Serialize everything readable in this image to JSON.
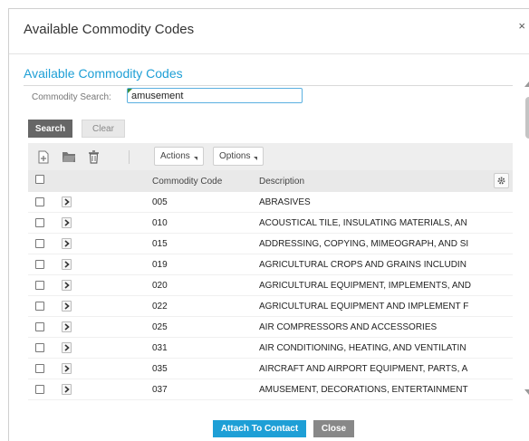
{
  "dialog": {
    "title": "Available Commodity Codes",
    "close_glyph": "×"
  },
  "section": {
    "title": "Available Commodity Codes"
  },
  "search": {
    "label": "Commodity Search:",
    "value": "amusement",
    "search_button": "Search",
    "clear_button": "Clear"
  },
  "toolbar": {
    "icons": [
      "add-icon",
      "folder-icon",
      "trash-icon"
    ],
    "actions_label": "Actions",
    "options_label": "Options"
  },
  "grid": {
    "columns": [
      "Commodity Code",
      "Description"
    ],
    "rows": [
      {
        "code": "005",
        "description": "ABRASIVES"
      },
      {
        "code": "010",
        "description": "ACOUSTICAL TILE, INSULATING MATERIALS, AN"
      },
      {
        "code": "015",
        "description": "ADDRESSING, COPYING, MIMEOGRAPH, AND SI"
      },
      {
        "code": "019",
        "description": "AGRICULTURAL CROPS AND GRAINS INCLUDIN"
      },
      {
        "code": "020",
        "description": "AGRICULTURAL EQUIPMENT, IMPLEMENTS, AND"
      },
      {
        "code": "022",
        "description": "AGRICULTURAL EQUIPMENT AND IMPLEMENT F"
      },
      {
        "code": "025",
        "description": "AIR COMPRESSORS AND ACCESSORIES"
      },
      {
        "code": "031",
        "description": "AIR CONDITIONING, HEATING, AND VENTILATIN"
      },
      {
        "code": "035",
        "description": "AIRCRAFT AND AIRPORT EQUIPMENT, PARTS, A"
      },
      {
        "code": "037",
        "description": "AMUSEMENT, DECORATIONS, ENTERTAINMENT"
      }
    ]
  },
  "footer": {
    "attach_button": "Attach To Contact",
    "close_button": "Close"
  },
  "colors": {
    "accent": "#1e9fd6",
    "search_button_bg": "#666666",
    "close_button_bg": "#888888"
  }
}
